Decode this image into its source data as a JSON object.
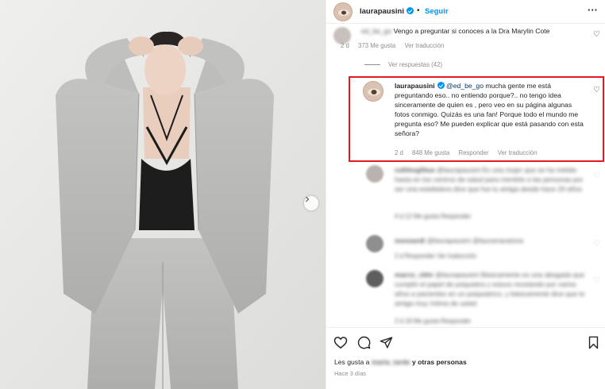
{
  "post": {
    "author": "laurapausini",
    "separator": "•",
    "follow_label": "Seguir",
    "more_label": "···"
  },
  "comments": {
    "first": {
      "user_blurred": "ed_be_go",
      "text": "Vengo a preguntar si conoces a la Dra Marylin Cote",
      "time": "2 d",
      "likes": "373 Me gusta",
      "translate": "Ver traducción"
    },
    "view_replies": "Ver respuestas (42)",
    "reply": {
      "user": "laurapausini",
      "mention": "@ed_be_go",
      "text_line1": " mucha gente me está",
      "text_rest": "preguntando eso.. no entiendo porque?.. no tengo idea sinceramente de quien es , pero veo en su página algunas fotos conmigo. Quizás es una fan! Porque todo el mundo me pregunta eso? Me pueden explicar que está pasando con esta señora?",
      "time": "2 d",
      "likes": "848 Me gusta",
      "reply_label": "Responder",
      "translate": "Ver traducción"
    },
    "blurred": [
      {
        "user": "ruthhogfitue",
        "text": "@laurapausini Es una mujer que se ha metido hasta en los centros de salud para mentirle a las personas por ser una estafadora dice que fue tu amiga desde hace 20 años",
        "meta": "4 d  12 Me gusta  Responder"
      },
      {
        "user": "monzardi",
        "text": "@laurapausini @lauramaratona",
        "meta": "2 d  Responder  Ver traducción"
      },
      {
        "user": "marco_ckhr",
        "text": "@laurapausini Básicamente es una abogada que cumplió el papel de psiquiatra y estuvo recetando por varios años a pacientes en un psiquiatrico, y básicamente dice que te amiga muy íntima de usted",
        "meta": "2 d  18 Me gusta  Responder"
      }
    ]
  },
  "footer": {
    "likes_prefix": "Les gusta a",
    "likes_user_blurred": "maria_tarde",
    "likes_suffix": "y otras personas",
    "time": "Hace 3 días"
  },
  "icons": [
    "more-icon",
    "heart-icon",
    "comment-icon",
    "share-icon",
    "bookmark-icon",
    "chevron-right-icon"
  ],
  "colors": {
    "accent": "#0095f6",
    "highlight": "#e21b22",
    "muted": "#8e8e8e",
    "photo_bg": "#e8e8e6",
    "suit": "#b9b9b7"
  }
}
